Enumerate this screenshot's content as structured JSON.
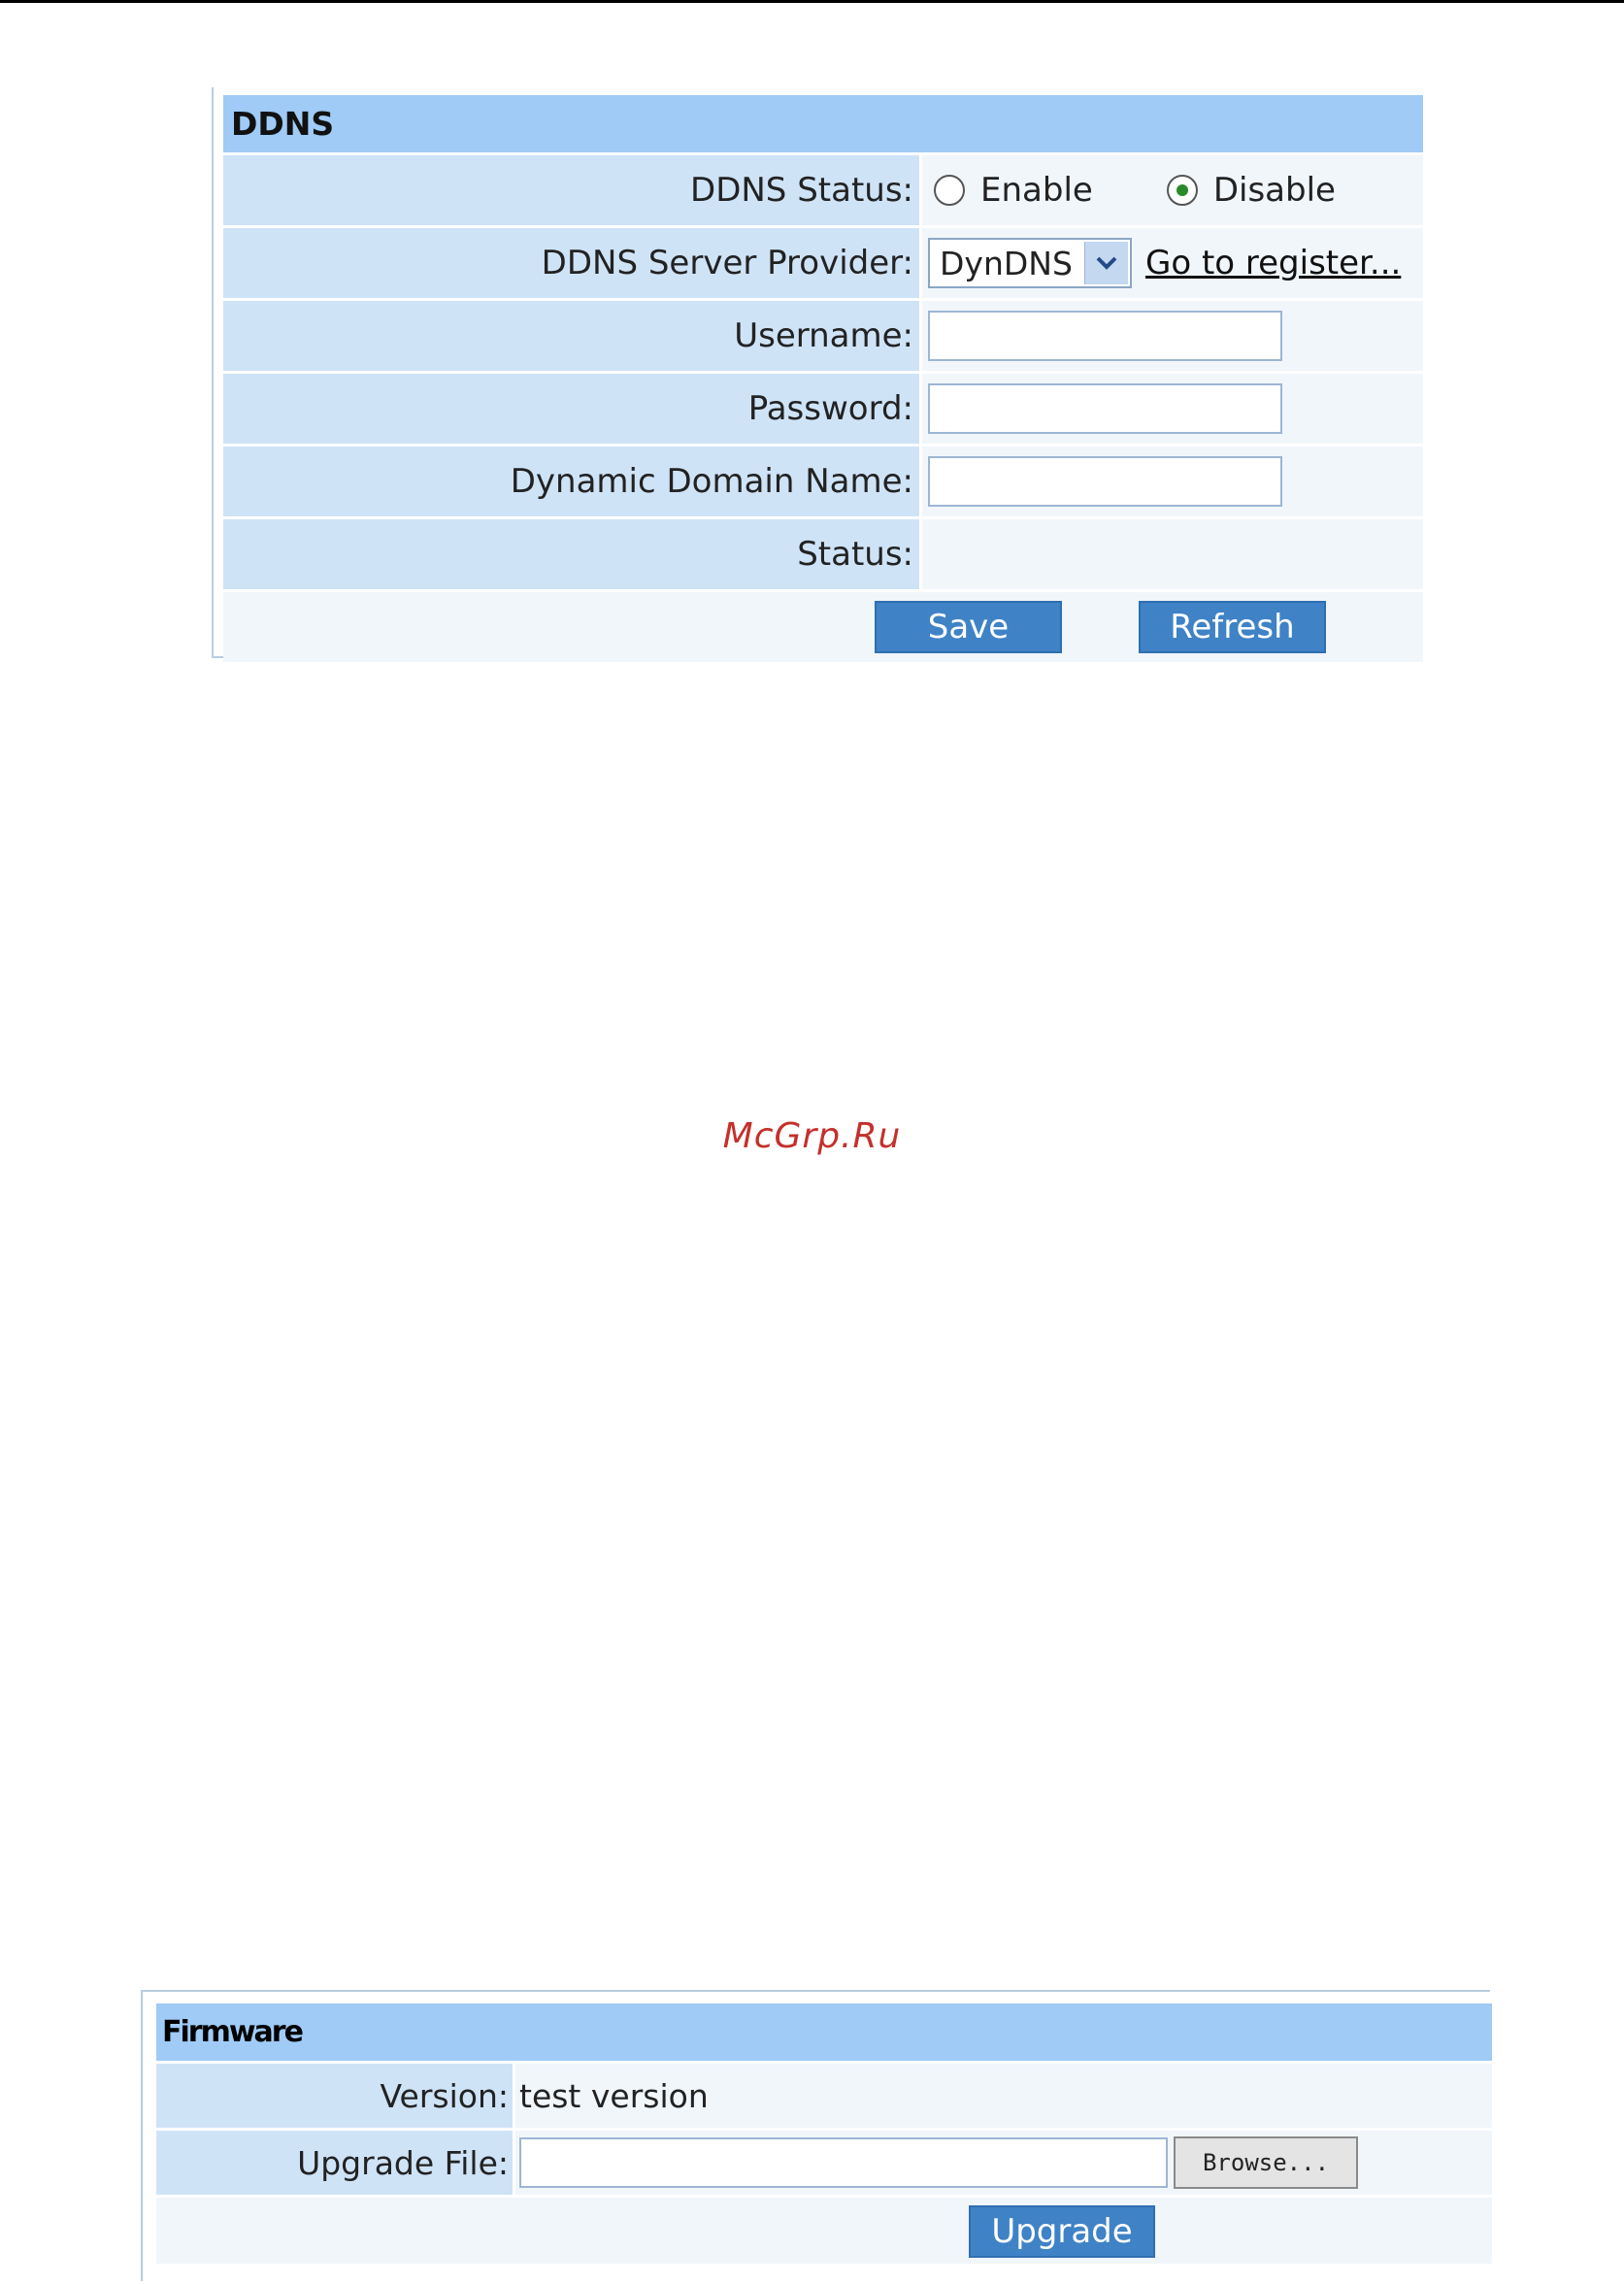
{
  "ddns": {
    "title": "DDNS",
    "status_label": "DDNS Status:",
    "status_options": [
      {
        "label": "Enable",
        "selected": false
      },
      {
        "label": "Disable",
        "selected": true
      }
    ],
    "provider_label": "DDNS Server Provider:",
    "provider_value": "DynDNS",
    "register_link": "Go to register...",
    "username_label": "Username:",
    "username_value": "",
    "password_label": "Password:",
    "password_value": "",
    "domain_label": "Dynamic Domain Name:",
    "domain_value": "",
    "status_text_label": "Status:",
    "status_text_value": "",
    "save_label": "Save",
    "refresh_label": "Refresh"
  },
  "watermark": "McGrp.Ru",
  "firmware": {
    "title": "Firmware",
    "version_label": "Version:",
    "version_value": "test version",
    "upgrade_file_label": "Upgrade File:",
    "browse_label": "Browse...",
    "upgrade_label": "Upgrade"
  },
  "colors": {
    "header_bg": "#9fcbf6",
    "label_bg": "#cfe3f7",
    "value_bg": "#f1f6fb",
    "button_bg": "#3f82c6",
    "watermark": "#c4302b"
  },
  "icons": {
    "select_arrow": "chevron-down-icon"
  }
}
